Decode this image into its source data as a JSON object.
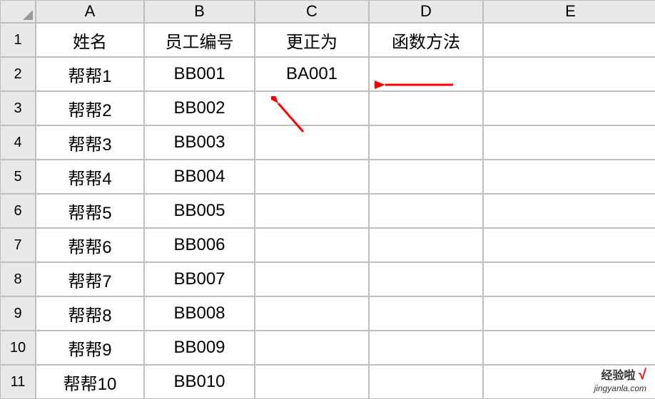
{
  "columns": [
    "A",
    "B",
    "C",
    "D",
    "E"
  ],
  "row_numbers": [
    "1",
    "2",
    "3",
    "4",
    "5",
    "6",
    "7",
    "8",
    "9",
    "10",
    "11"
  ],
  "headers": {
    "A": "姓名",
    "B": "员工编号",
    "C": "更正为",
    "D": "函数方法"
  },
  "rows": [
    {
      "A": "帮帮1",
      "B": "BB001",
      "C": "BA001",
      "D": ""
    },
    {
      "A": "帮帮2",
      "B": "BB002",
      "C": "",
      "D": ""
    },
    {
      "A": "帮帮3",
      "B": "BB003",
      "C": "",
      "D": ""
    },
    {
      "A": "帮帮4",
      "B": "BB004",
      "C": "",
      "D": ""
    },
    {
      "A": "帮帮5",
      "B": "BB005",
      "C": "",
      "D": ""
    },
    {
      "A": "帮帮6",
      "B": "BB006",
      "C": "",
      "D": ""
    },
    {
      "A": "帮帮7",
      "B": "BB007",
      "C": "",
      "D": ""
    },
    {
      "A": "帮帮8",
      "B": "BB008",
      "C": "",
      "D": ""
    },
    {
      "A": "帮帮9",
      "B": "BB009",
      "C": "",
      "D": ""
    },
    {
      "A": "帮帮10",
      "B": "BB010",
      "C": "",
      "D": ""
    }
  ],
  "watermark": {
    "title": "经验啦",
    "url": "jingyanla.com"
  }
}
